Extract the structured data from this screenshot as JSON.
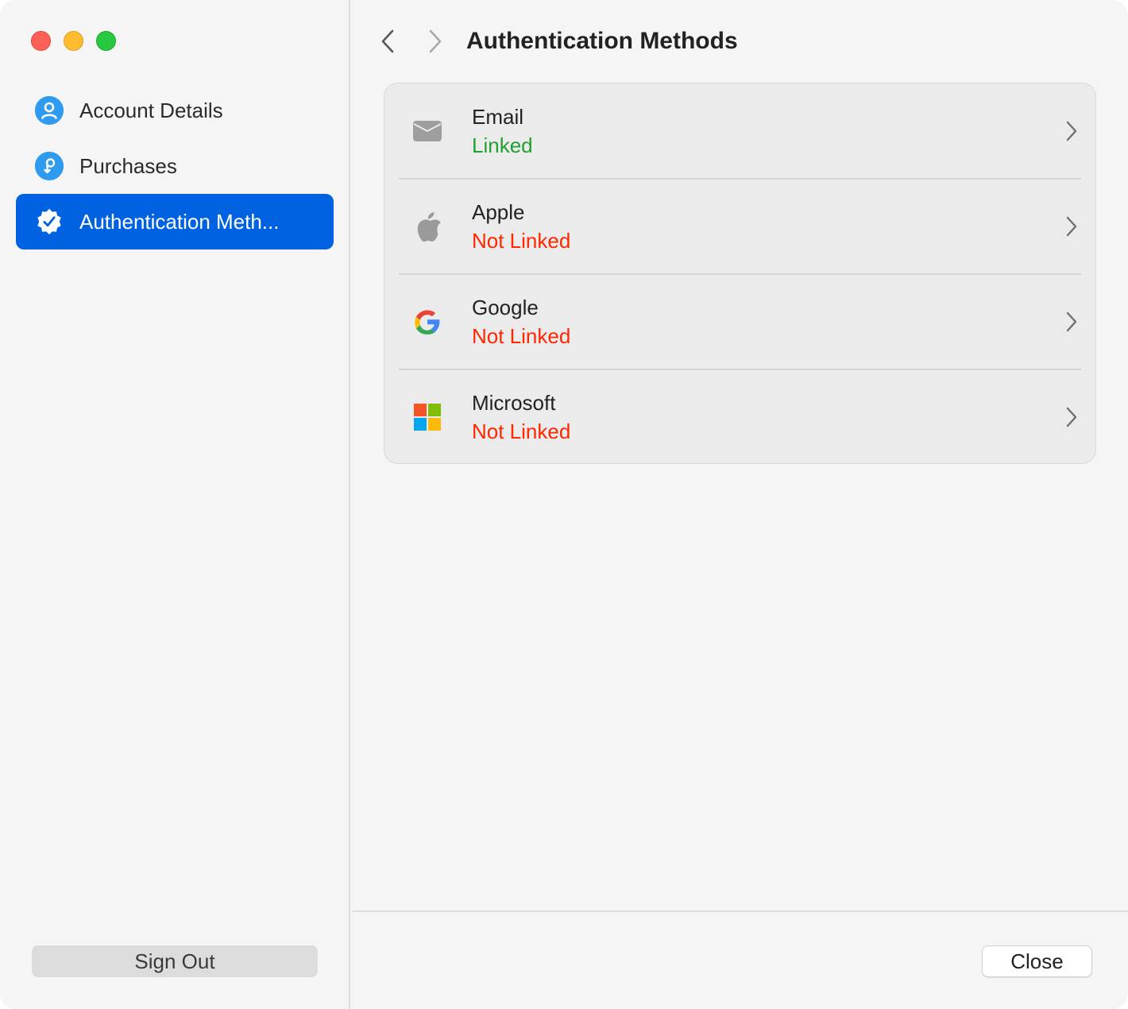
{
  "window": {
    "title": "Authentication Methods"
  },
  "sidebar": {
    "items": [
      {
        "label": "Account Details",
        "icon": "person-icon",
        "active": false
      },
      {
        "label": "Purchases",
        "icon": "purchases-icon",
        "active": false
      },
      {
        "label": "Authentication Meth...",
        "icon": "verified-badge-icon",
        "active": true
      }
    ],
    "sign_out_label": "Sign Out"
  },
  "main": {
    "title": "Authentication Methods",
    "methods": [
      {
        "name": "Email",
        "status": "Linked",
        "icon": "envelope-icon"
      },
      {
        "name": "Apple",
        "status": "Not Linked",
        "icon": "apple-logo-icon"
      },
      {
        "name": "Google",
        "status": "Not Linked",
        "icon": "google-logo-icon"
      },
      {
        "name": "Microsoft",
        "status": "Not Linked",
        "icon": "microsoft-logo-icon"
      }
    ],
    "close_label": "Close"
  },
  "colors": {
    "accent": "#0062e1",
    "linked": "#1ea12f",
    "not_linked": "#ff2600",
    "icon_blue": "#2e9bf0"
  }
}
